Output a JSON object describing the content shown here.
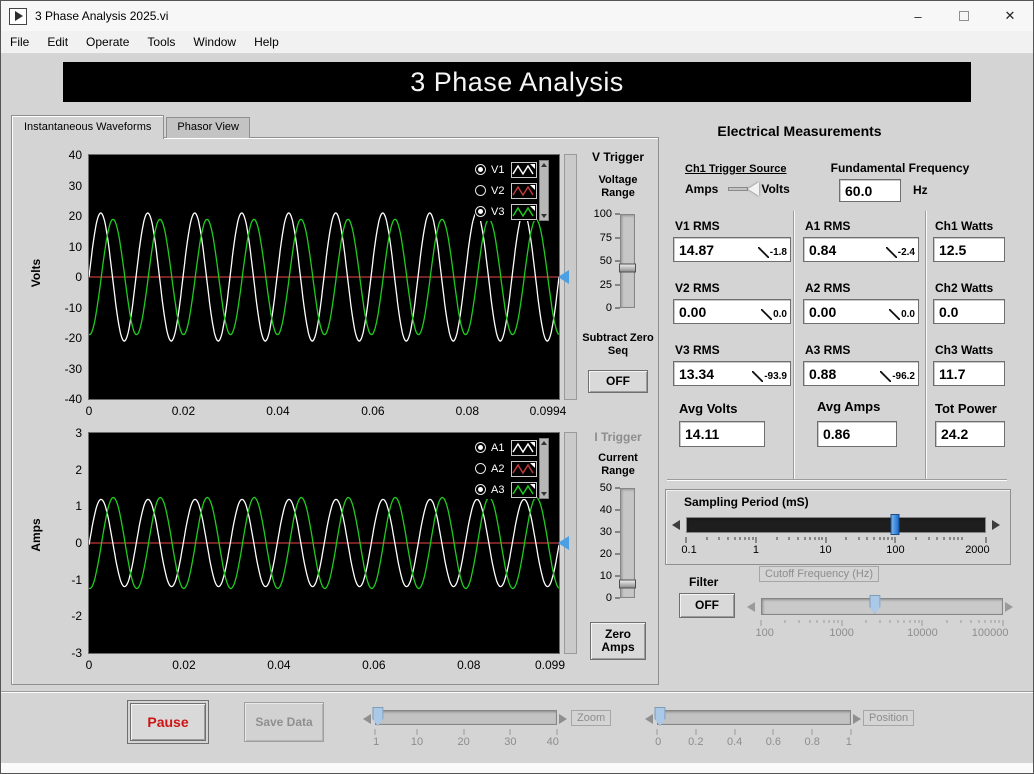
{
  "window": {
    "title": "3 Phase Analysis 2025.vi",
    "controls": {
      "minimize": "–",
      "close": "✕"
    }
  },
  "menu": {
    "items": [
      "File",
      "Edit",
      "Operate",
      "Tools",
      "Window",
      "Help"
    ]
  },
  "banner": {
    "title": "3 Phase Analysis"
  },
  "tabs": {
    "instantaneous": "Instantaneous Waveforms",
    "phasor": "Phasor View"
  },
  "chart_data": [
    {
      "type": "line",
      "name": "volts-waveform-graph",
      "ylabel": "Volts",
      "ylim": [
        -40,
        40
      ],
      "yticks": [
        "40",
        "30",
        "20",
        "10",
        "0",
        "-10",
        "-20",
        "-30",
        "-40"
      ],
      "xlim": [
        0,
        0.0994
      ],
      "xticks": [
        {
          "label": "0",
          "pos": 0
        },
        {
          "label": "0.02",
          "pos": 0.201
        },
        {
          "label": "0.04",
          "pos": 0.402
        },
        {
          "label": "0.06",
          "pos": 0.604
        },
        {
          "label": "0.08",
          "pos": 0.805
        },
        {
          "label": "0.0994",
          "pos": 1
        }
      ],
      "cycles": 10,
      "plot_bg": "#000000",
      "trigger_frac": 0.5,
      "draw_order": [
        1,
        0,
        2
      ],
      "series": [
        {
          "name": "V1",
          "color": "#ffffff",
          "amplitude": 21.0,
          "phase_deg": 0,
          "selected": true
        },
        {
          "name": "V2",
          "color": "#c03a3a",
          "amplitude": 0.0,
          "phase_deg": 0,
          "selected": false
        },
        {
          "name": "V3",
          "color": "#1ecc1e",
          "amplitude": 18.9,
          "phase_deg": -93.9,
          "selected": true
        }
      ]
    },
    {
      "type": "line",
      "name": "amps-waveform-graph",
      "ylabel": "Amps",
      "ylim": [
        -3,
        3
      ],
      "yticks": [
        "3",
        "2",
        "1",
        "0",
        "-1",
        "-2",
        "-3"
      ],
      "xlim": [
        0,
        0.099
      ],
      "xticks": [
        {
          "label": "0",
          "pos": 0
        },
        {
          "label": "0.02",
          "pos": 0.202
        },
        {
          "label": "0.04",
          "pos": 0.404
        },
        {
          "label": "0.06",
          "pos": 0.606
        },
        {
          "label": "0.08",
          "pos": 0.808
        },
        {
          "label": "0.099",
          "pos": 1
        }
      ],
      "cycles": 10,
      "plot_bg": "#000000",
      "trigger_frac": 0.5,
      "draw_order": [
        1,
        0,
        2
      ],
      "series": [
        {
          "name": "A1",
          "color": "#ffffff",
          "amplitude": 1.19,
          "phase_deg": -2.4,
          "selected": true
        },
        {
          "name": "A2",
          "color": "#c03a3a",
          "amplitude": 0.0,
          "phase_deg": 0,
          "selected": false
        },
        {
          "name": "A3",
          "color": "#1ecc1e",
          "amplitude": 1.24,
          "phase_deg": -96.2,
          "selected": true
        }
      ]
    }
  ],
  "v_trigger": {
    "title": "V Trigger",
    "range_label": "Voltage Range",
    "scale": {
      "labels": [
        "100",
        "75",
        "50",
        "25",
        "0"
      ]
    },
    "handle_frac": 0.58,
    "subtract_label": "Subtract Zero Seq",
    "subtract_button": "OFF"
  },
  "i_trigger": {
    "title": "I Trigger",
    "range_label": "Current Range",
    "scale": {
      "labels": [
        "50",
        "40",
        "30",
        "20",
        "10",
        "0"
      ]
    },
    "handle_frac": 0.88,
    "zero_button": "Zero Amps"
  },
  "measurements": {
    "title": "Electrical Measurements",
    "trigger_source": {
      "label": "Ch1 Trigger Source",
      "left": "Amps",
      "right": "Volts"
    },
    "frequency": {
      "label": "Fundamental Frequency",
      "value": "60.0",
      "unit": "Hz"
    },
    "columns": [
      {
        "rows": [
          {
            "label": "V1 RMS",
            "value": "14.87",
            "angle": "-1.8"
          },
          {
            "label": "V2 RMS",
            "value": "0.00",
            "angle": "0.0"
          },
          {
            "label": "V3 RMS",
            "value": "13.34",
            "angle": "-93.9"
          }
        ],
        "avg_label": "Avg Volts",
        "avg_value": "14.11"
      },
      {
        "rows": [
          {
            "label": "A1 RMS",
            "value": "0.84",
            "angle": "-2.4"
          },
          {
            "label": "A2 RMS",
            "value": "0.00",
            "angle": "0.0"
          },
          {
            "label": "A3 RMS",
            "value": "0.88",
            "angle": "-96.2"
          }
        ],
        "avg_label": "Avg Amps",
        "avg_value": "0.86"
      },
      {
        "rows": [
          {
            "label": "Ch1 Watts",
            "value": "12.5"
          },
          {
            "label": "Ch2 Watts",
            "value": "0.0"
          },
          {
            "label": "Ch3 Watts",
            "value": "11.7"
          }
        ],
        "avg_label": "Tot Power",
        "avg_value": "24.2"
      }
    ]
  },
  "sampling": {
    "label": "Sampling Period (mS)",
    "value_frac": 0.698,
    "scale": {
      "labels": [
        "0.1",
        "1",
        "10",
        "100",
        "2000"
      ],
      "positions": [
        0,
        0.233,
        0.465,
        0.698,
        1
      ],
      "log": {
        "min": 0.1,
        "max": 2000
      }
    }
  },
  "filter": {
    "label": "Filter",
    "button": "OFF",
    "cutoff": {
      "label": "Cutoff Frequency (Hz)",
      "value_frac": 0.47,
      "scale": {
        "labels": [
          "100",
          "1000",
          "10000",
          "100000"
        ],
        "positions": [
          0,
          0.333,
          0.667,
          1
        ],
        "log": {
          "min": 100,
          "max": 100000
        }
      }
    }
  },
  "footer": {
    "pause": "Pause",
    "save": "Save Data",
    "zoom": {
      "label": "Zoom",
      "value_frac": 0.01,
      "scale": {
        "labels": [
          "1",
          "10",
          "20",
          "30",
          "40"
        ],
        "positions": [
          0,
          0.231,
          0.487,
          0.744,
          1
        ]
      }
    },
    "position": {
      "label": "Position",
      "value_frac": 0.01,
      "scale": {
        "labels": [
          "0",
          "0.2",
          "0.4",
          "0.6",
          "0.8",
          "1"
        ],
        "positions": [
          0,
          0.2,
          0.4,
          0.6,
          0.8,
          1
        ]
      }
    }
  }
}
